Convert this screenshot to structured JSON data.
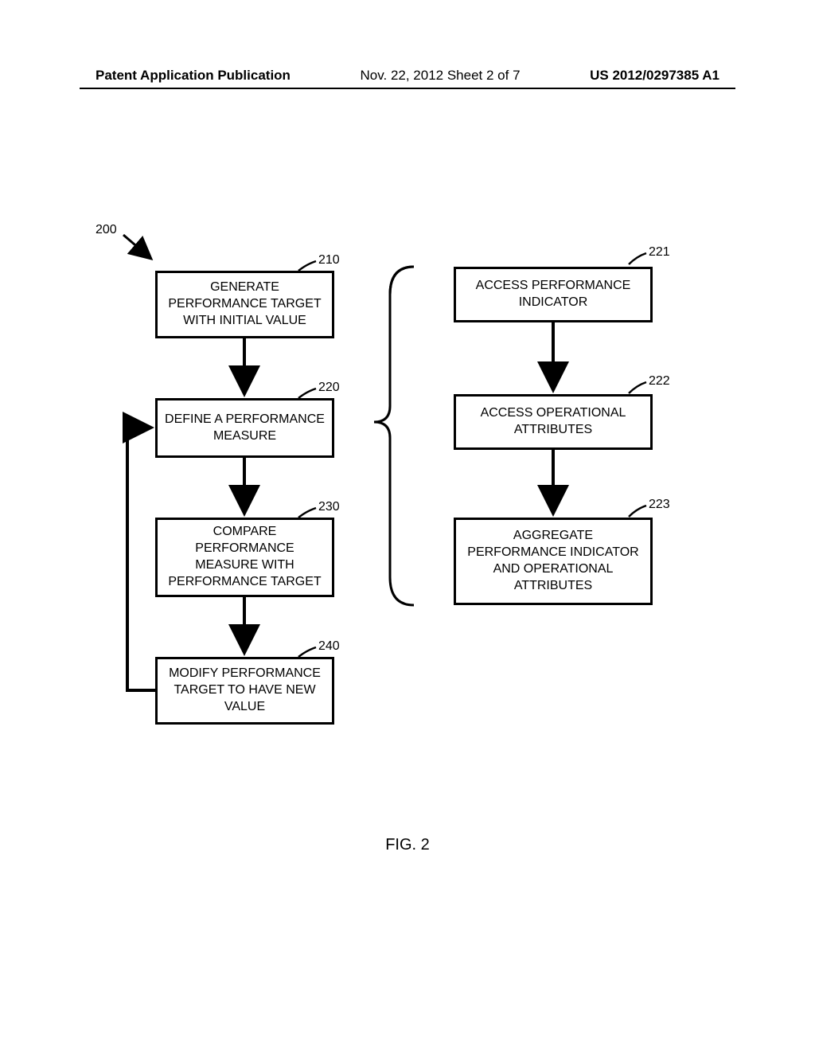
{
  "header": {
    "left": "Patent Application Publication",
    "middle": "Nov. 22, 2012  Sheet 2 of 7",
    "right": "US 2012/0297385 A1"
  },
  "labels": {
    "ref200": "200",
    "ref210": "210",
    "ref220": "220",
    "ref230": "230",
    "ref240": "240",
    "ref221": "221",
    "ref222": "222",
    "ref223": "223"
  },
  "boxes": {
    "b210": "GENERATE PERFORMANCE TARGET WITH INITIAL VALUE",
    "b220": "DEFINE A PERFORMANCE MEASURE",
    "b230": "COMPARE PERFORMANCE MEASURE WITH PERFORMANCE TARGET",
    "b240": "MODIFY PERFORMANCE TARGET TO HAVE NEW VALUE",
    "b221": "ACCESS PERFORMANCE INDICATOR",
    "b222": "ACCESS OPERATIONAL ATTRIBUTES",
    "b223": "AGGREGATE PERFORMANCE INDICATOR AND OPERATIONAL ATTRIBUTES"
  },
  "figure": "FIG. 2"
}
